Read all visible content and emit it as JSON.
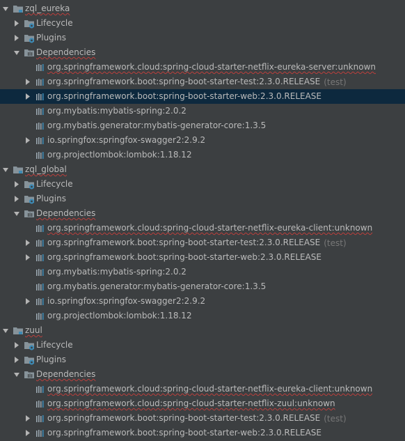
{
  "colors": {
    "background": "#3c3f41",
    "selection": "#0d293e",
    "text": "#bbbbbb",
    "muted": "#787878",
    "error_underline": "#bc3f3c",
    "folder_icon": "#87939a",
    "gear_badge": "#3d8ab5",
    "bar_icon": "#9aa7b0"
  },
  "tree": [
    {
      "label": "zql_eureka",
      "icon": "module-folder-icon",
      "expanded": true,
      "level": 0,
      "wavy": true
    },
    {
      "label": "Lifecycle",
      "icon": "gear-folder-icon",
      "expanded": false,
      "level": 1
    },
    {
      "label": "Plugins",
      "icon": "gear-folder-icon",
      "expanded": false,
      "level": 1
    },
    {
      "label": "Dependencies",
      "icon": "library-folder-icon",
      "expanded": true,
      "level": 1,
      "wavy": true
    },
    {
      "label": "org.springframework.cloud:spring-cloud-starter-netflix-eureka-server:unknown",
      "icon": "library-icon",
      "level": 2,
      "wavy": true
    },
    {
      "label": "org.springframework.boot:spring-boot-starter-test:2.3.0.RELEASE",
      "scope": "(test)",
      "icon": "library-icon",
      "expanded": false,
      "level": 2
    },
    {
      "label": "org.springframework.boot:spring-boot-starter-web:2.3.0.RELEASE",
      "icon": "library-icon",
      "expanded": false,
      "level": 2,
      "selected": true
    },
    {
      "label": "org.mybatis:mybatis-spring:2.0.2",
      "icon": "library-icon",
      "level": 2
    },
    {
      "label": "org.mybatis.generator:mybatis-generator-core:1.3.5",
      "icon": "library-icon",
      "level": 2
    },
    {
      "label": "io.springfox:springfox-swagger2:2.9.2",
      "icon": "library-icon",
      "expanded": false,
      "level": 2
    },
    {
      "label": "org.projectlombok:lombok:1.18.12",
      "icon": "library-icon",
      "level": 2
    },
    {
      "label": "zql_global",
      "icon": "module-folder-icon",
      "expanded": true,
      "level": 0,
      "wavy": true
    },
    {
      "label": "Lifecycle",
      "icon": "gear-folder-icon",
      "expanded": false,
      "level": 1
    },
    {
      "label": "Plugins",
      "icon": "gear-folder-icon",
      "expanded": false,
      "level": 1
    },
    {
      "label": "Dependencies",
      "icon": "library-folder-icon",
      "expanded": true,
      "level": 1,
      "wavy": true
    },
    {
      "label": "org.springframework.cloud:spring-cloud-starter-netflix-eureka-client:unknown",
      "icon": "library-icon",
      "level": 2,
      "wavy": true
    },
    {
      "label": "org.springframework.boot:spring-boot-starter-test:2.3.0.RELEASE",
      "scope": "(test)",
      "icon": "library-icon",
      "expanded": false,
      "level": 2
    },
    {
      "label": "org.springframework.boot:spring-boot-starter-web:2.3.0.RELEASE",
      "icon": "library-icon",
      "expanded": false,
      "level": 2
    },
    {
      "label": "org.mybatis:mybatis-spring:2.0.2",
      "icon": "library-icon",
      "level": 2
    },
    {
      "label": "org.mybatis.generator:mybatis-generator-core:1.3.5",
      "icon": "library-icon",
      "level": 2
    },
    {
      "label": "io.springfox:springfox-swagger2:2.9.2",
      "icon": "library-icon",
      "expanded": false,
      "level": 2
    },
    {
      "label": "org.projectlombok:lombok:1.18.12",
      "icon": "library-icon",
      "level": 2
    },
    {
      "label": "zuul",
      "icon": "module-folder-icon",
      "expanded": true,
      "level": 0,
      "wavy": true
    },
    {
      "label": "Lifecycle",
      "icon": "gear-folder-icon",
      "expanded": false,
      "level": 1
    },
    {
      "label": "Plugins",
      "icon": "gear-folder-icon",
      "expanded": false,
      "level": 1
    },
    {
      "label": "Dependencies",
      "icon": "library-folder-icon",
      "expanded": true,
      "level": 1,
      "wavy": true
    },
    {
      "label": "org.springframework.cloud:spring-cloud-starter-netflix-eureka-client:unknown",
      "icon": "library-icon",
      "level": 2,
      "wavy": true
    },
    {
      "label": "org.springframework.cloud:spring-cloud-starter-netflix-zuul:unknown",
      "icon": "library-icon",
      "level": 2,
      "wavy": true
    },
    {
      "label": "org.springframework.boot:spring-boot-starter-test:2.3.0.RELEASE",
      "scope": "(test)",
      "icon": "library-icon",
      "expanded": false,
      "level": 2
    },
    {
      "label": "org.springframework.boot:spring-boot-starter-web:2.3.0.RELEASE",
      "icon": "library-icon",
      "expanded": false,
      "level": 2
    }
  ]
}
